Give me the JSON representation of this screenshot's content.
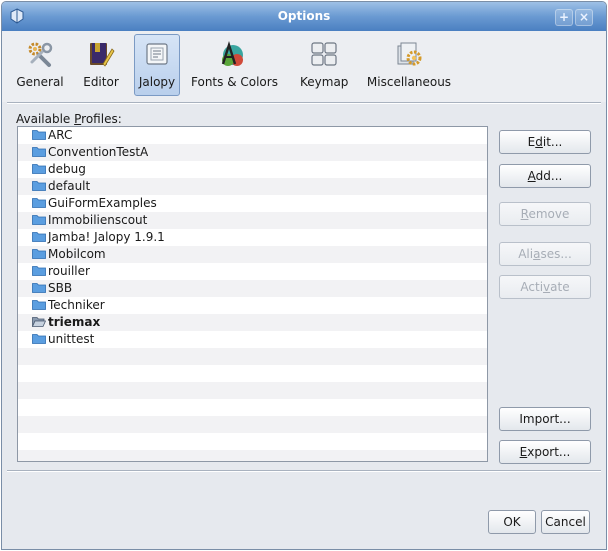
{
  "window": {
    "title": "Options",
    "controls": [
      "+",
      "×"
    ]
  },
  "categories": [
    {
      "label": "General",
      "icon": "general-settings-icon"
    },
    {
      "label": "Editor",
      "icon": "editor-icon"
    },
    {
      "label": "Jalopy",
      "icon": "jalopy-icon",
      "selected": true
    },
    {
      "label": "Fonts & Colors",
      "icon": "fonts-colors-icon"
    },
    {
      "label": "Keymap",
      "icon": "keymap-icon"
    },
    {
      "label": "Miscellaneous",
      "icon": "miscellaneous-icon"
    }
  ],
  "profiles": {
    "label": "Available Profiles:",
    "items": [
      {
        "name": "ARC"
      },
      {
        "name": "ConventionTestA"
      },
      {
        "name": "debug"
      },
      {
        "name": "default"
      },
      {
        "name": "GuiFormExamples"
      },
      {
        "name": "Immobilienscout"
      },
      {
        "name": "Jamba! Jalopy 1.9.1"
      },
      {
        "name": "Mobilcom"
      },
      {
        "name": "rouiller"
      },
      {
        "name": "SBB"
      },
      {
        "name": "Techniker"
      },
      {
        "name": "triemax",
        "active": true
      },
      {
        "name": "unittest"
      }
    ]
  },
  "buttons": {
    "edit": "Edit...",
    "add": "Add...",
    "remove": "Remove",
    "aliases": "Aliases...",
    "activate": "Activate",
    "import": "Import...",
    "export": "Export...",
    "ok": "OK",
    "cancel": "Cancel"
  }
}
